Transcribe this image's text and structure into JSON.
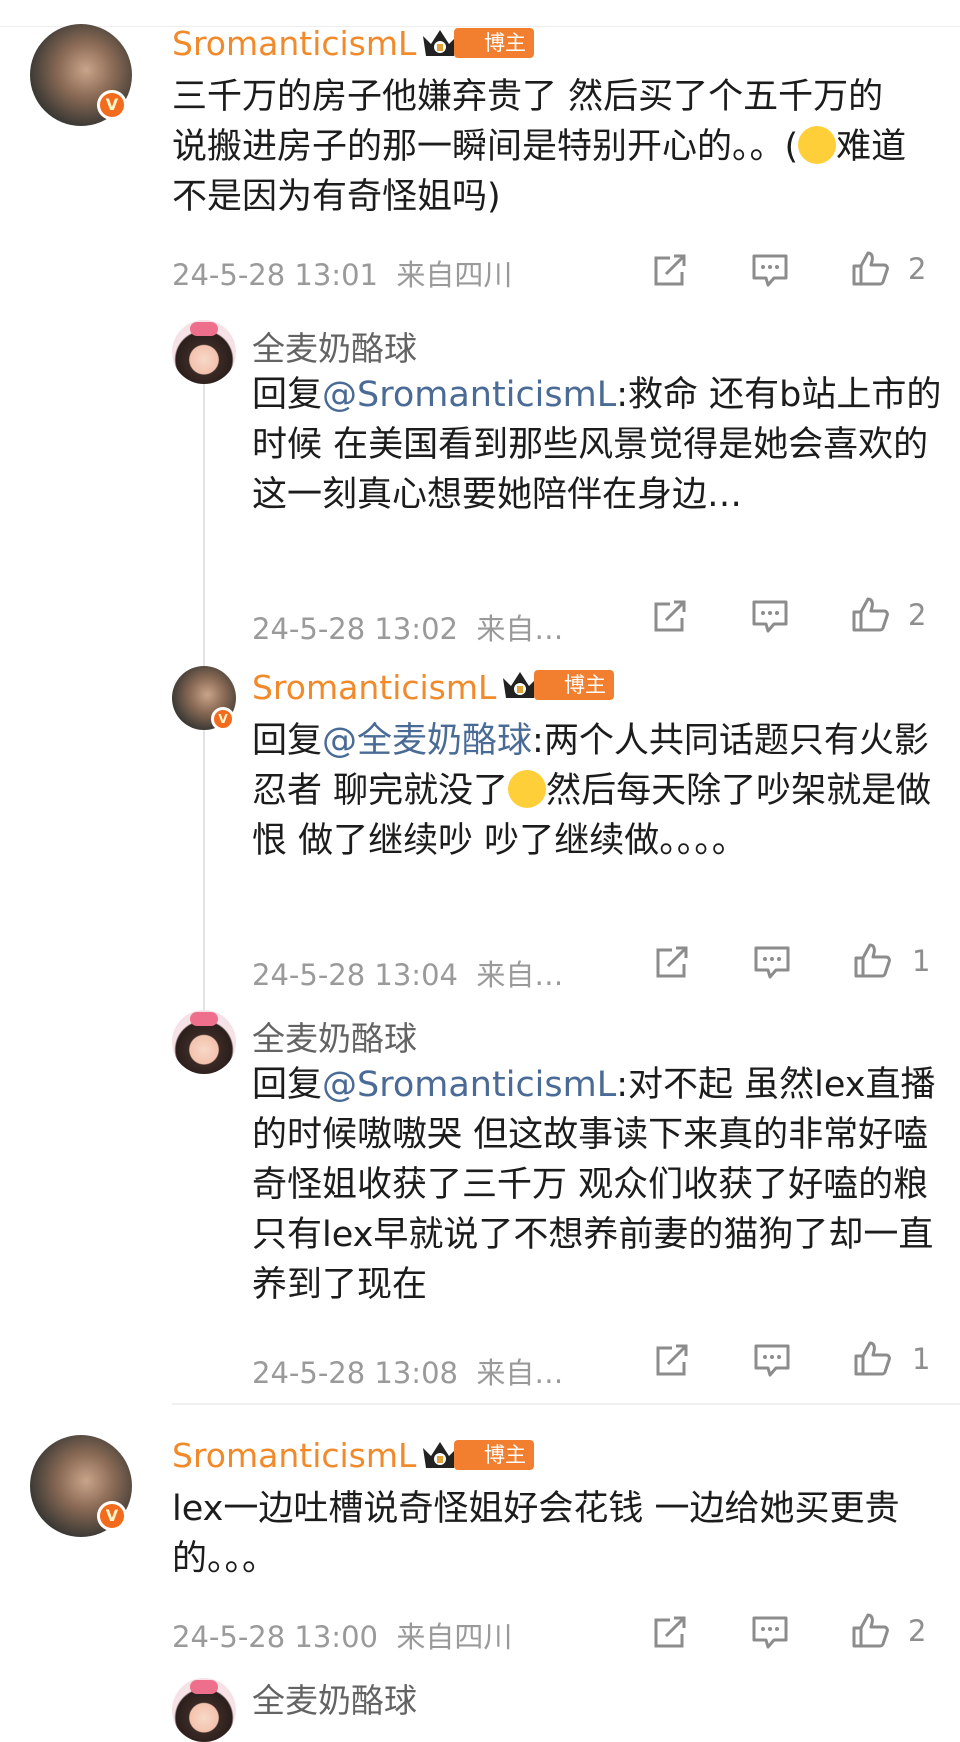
{
  "comments": [
    {
      "name": "SromanticismL",
      "tag": "博主",
      "content": "三千万的房子他嫌弃贵了 然后买了个五千万的 说搬进房子的那一瞬间是特别开心的。。(",
      "content_tail": "难道不是因为有奇怪姐吗)",
      "emoji": "astonished-emoji",
      "time": "24-5-28 13:01",
      "location": "来自四川",
      "likes": "2",
      "replies": [
        {
          "name": "全麦奶酪球",
          "reply_prefix": "回复",
          "mention": "@SromanticismL",
          "content": ":救命 还有b站上市的时候 在美国看到那些风景觉得是她会喜欢的 这一刻真心想要她陪伴在身边…",
          "time": "24-5-28 13:02",
          "location": "来自…",
          "likes": "2"
        },
        {
          "name": "SromanticismL",
          "tag": "博主",
          "reply_prefix": "回复",
          "mention": "@全麦奶酪球",
          "content": ":两个人共同话题只有火影忍者 聊完就没了",
          "emoji": "crying-laughing-emoji",
          "content_tail": "然后每天除了吵架就是做恨 做了继续吵 吵了继续做。。。。",
          "time": "24-5-28 13:04",
          "location": "来自…",
          "likes": "1"
        },
        {
          "name": "全麦奶酪球",
          "reply_prefix": "回复",
          "mention": "@SromanticismL",
          "content": ":对不起 虽然lex直播的时候嗷嗷哭 但这故事读下来真的非常好嗑 奇怪姐收获了三千万 观众们收获了好嗑的粮 只有lex早就说了不想养前妻的猫狗了却一直养到了现在",
          "time": "24-5-28 13:08",
          "location": "来自…",
          "likes": "1"
        }
      ]
    },
    {
      "name": "SromanticismL",
      "tag": "博主",
      "content": "lex一边吐槽说奇怪姐好会花钱 一边给她买更贵的。。。",
      "time": "24-5-28 13:00",
      "location": "来自四川",
      "likes": "2"
    }
  ],
  "next_preview_name": "全麦奶酪球",
  "colors": {
    "author": "#f08a2a",
    "mention": "#4a6b96",
    "tag_bg": "#f27f2f",
    "meta": "#9a9a9a"
  },
  "icons": [
    "share-icon",
    "comment-icon",
    "like-icon",
    "crown-icon",
    "verified-v-icon"
  ]
}
